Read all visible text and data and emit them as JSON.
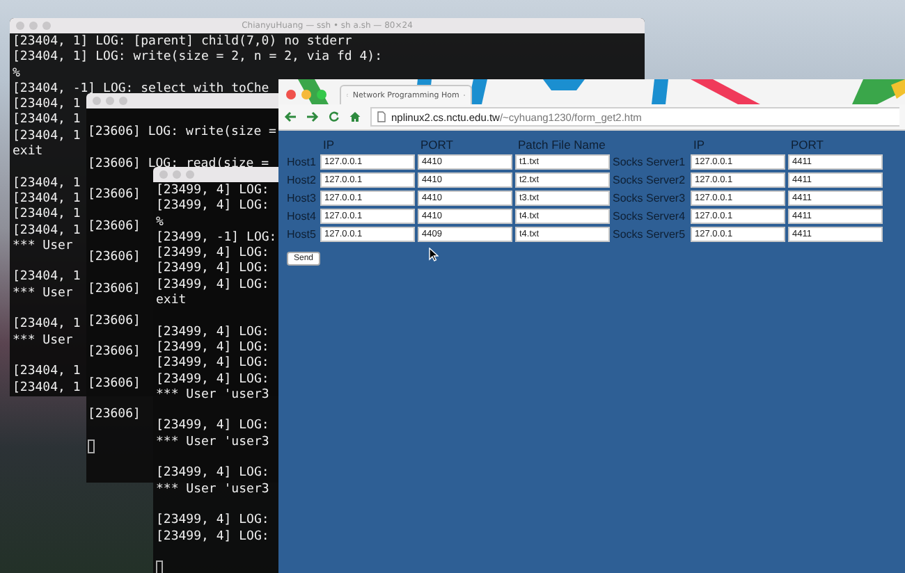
{
  "terminals": [
    {
      "title": "ChianyuHuang — ssh • sh a.sh — 80×24",
      "blocks": [
        [
          "[23404, 1] LOG: [parent] child(7,0) no stderr",
          "[23404, 1] LOG: write(size = 2, n = 2, via fd 4):",
          "%",
          "[23404, -1] LOG: select with toChe",
          "[23404, 1",
          "[23404, 1",
          "[23404, 1",
          "exit"
        ],
        [
          "[23404, 1",
          "[23404, 1",
          "[23404, 1",
          "[23404, 1",
          "*** User"
        ],
        [
          "[23404, 1",
          "*** User"
        ],
        [
          "[23404, 1",
          "*** User"
        ],
        [
          "[23404, 1",
          "[23404, 1"
        ]
      ]
    },
    {
      "blocks": [
        [
          "[23606] LOG: write(size ="
        ],
        [
          "[23606] LOG: read(size ="
        ],
        [
          "[23606]"
        ],
        [
          "[23606]"
        ],
        [
          "[23606]"
        ],
        [
          "[23606]"
        ],
        [
          "[23606]"
        ],
        [
          "[23606]"
        ],
        [
          "[23606]"
        ],
        [
          "[23606]"
        ]
      ]
    },
    {
      "blocks": [
        [
          "[23499, 4] LOG:",
          "[23499, 4] LOG:",
          "%",
          "[23499, -1] LOG:",
          "[23499, 4] LOG:",
          "[23499, 4] LOG:",
          "[23499, 4] LOG:",
          "exit"
        ],
        [
          "[23499, 4] LOG:",
          "[23499, 4] LOG:",
          "[23499, 4] LOG:",
          "[23499, 4] LOG:",
          "*** User 'user3"
        ],
        [
          "[23499, 4] LOG:",
          "*** User 'user3"
        ],
        [
          "[23499, 4] LOG:",
          "*** User 'user3"
        ],
        [
          "[23499, 4] LOG:",
          "[23499, 4] LOG:"
        ]
      ]
    }
  ],
  "browser": {
    "tab_title": "Network Programming Hom",
    "url_host": "nplinux2.cs.nctu.edu.tw",
    "url_path": "/~cyhuang1230/form_get2.htm",
    "form": {
      "columns": [
        "IP",
        "PORT",
        "Patch File Name",
        "IP",
        "PORT"
      ],
      "rows": [
        {
          "host_label": "Host1",
          "ip": "127.0.0.1",
          "port": "4410",
          "file": "t1.txt",
          "socks_label": "Socks Server1",
          "socks_ip": "127.0.0.1",
          "socks_port": "4411"
        },
        {
          "host_label": "Host2",
          "ip": "127.0.0.1",
          "port": "4410",
          "file": "t2.txt",
          "socks_label": "Socks Server2",
          "socks_ip": "127.0.0.1",
          "socks_port": "4411"
        },
        {
          "host_label": "Host3",
          "ip": "127.0.0.1",
          "port": "4410",
          "file": "t3.txt",
          "socks_label": "Socks Server3",
          "socks_ip": "127.0.0.1",
          "socks_port": "4411"
        },
        {
          "host_label": "Host4",
          "ip": "127.0.0.1",
          "port": "4410",
          "file": "t4.txt",
          "socks_label": "Socks Server4",
          "socks_ip": "127.0.0.1",
          "socks_port": "4411"
        },
        {
          "host_label": "Host5",
          "ip": "127.0.0.1",
          "port": "4409",
          "file": "t4.txt",
          "socks_label": "Socks Server5",
          "socks_ip": "127.0.0.1",
          "socks_port": "4411"
        }
      ],
      "submit": "Send"
    }
  }
}
